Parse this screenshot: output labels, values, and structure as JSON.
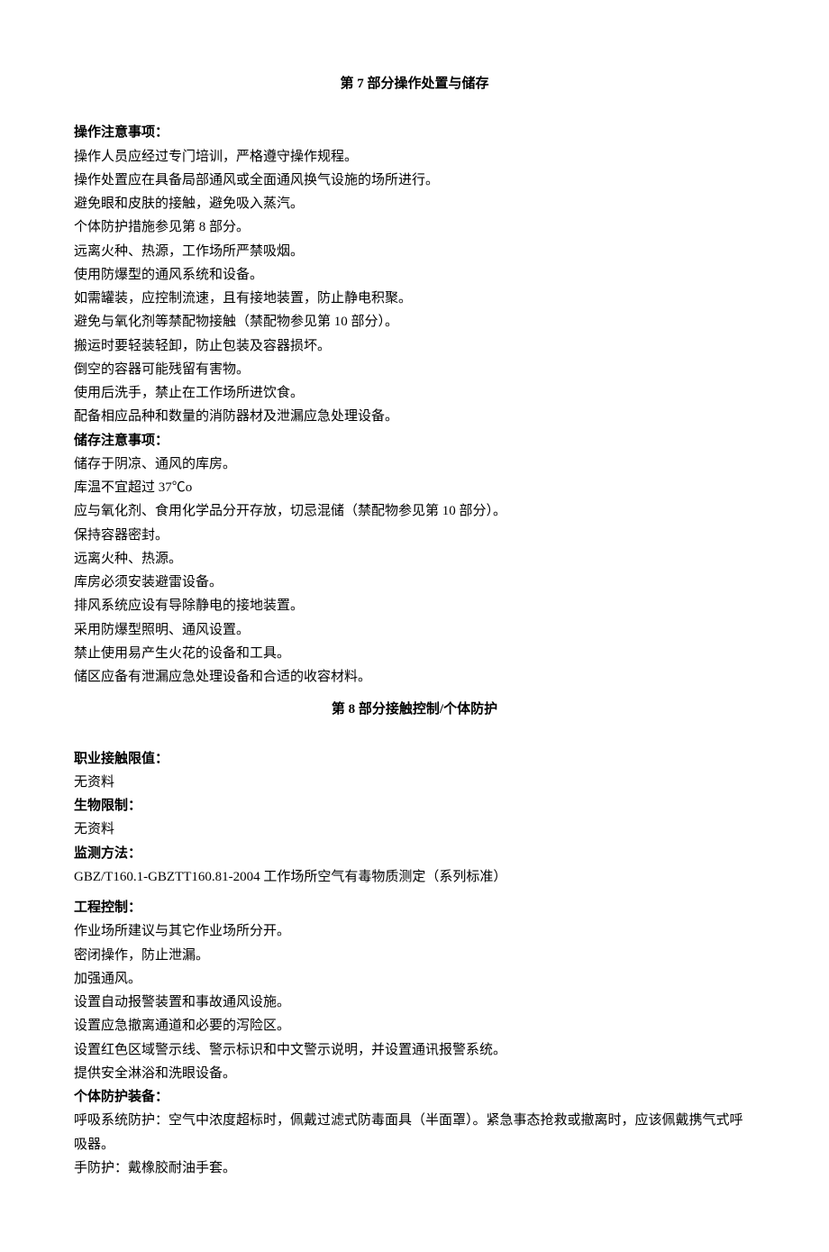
{
  "section7": {
    "title": "第 7 部分操作处置与储存",
    "handling_label": "操作注意事项：",
    "handling_lines": [
      "操作人员应经过专门培训，严格遵守操作规程。",
      "操作处置应在具备局部通风或全面通风换气设施的场所进行。",
      "避免眼和皮肤的接触，避免吸入蒸汽。",
      "个体防护措施参见第 8 部分。",
      "远离火种、热源，工作场所严禁吸烟。",
      "使用防爆型的通风系统和设备。",
      "如需罐装，应控制流速，且有接地装置，防止静电积聚。",
      "避免与氧化剂等禁配物接触（禁配物参见第 10 部分）。",
      "搬运时要轻装轻卸，防止包装及容器损坏。",
      "倒空的容器可能残留有害物。",
      "使用后洗手，禁止在工作场所进饮食。",
      "配备相应品种和数量的消防器材及泄漏应急处理设备。"
    ],
    "storage_label": "储存注意事项：",
    "storage_lines": [
      "储存于阴凉、通风的库房。",
      "库温不宜超过 37℃o",
      "应与氧化剂、食用化学品分开存放，切忌混储（禁配物参见第 10 部分）。",
      "保持容器密封。",
      "远离火种、热源。",
      "库房必须安装避雷设备。",
      "排风系统应设有导除静电的接地装置。",
      "采用防爆型照明、通风设置。",
      "禁止使用易产生火花的设备和工具。",
      "储区应备有泄漏应急处理设备和合适的收容材料。"
    ]
  },
  "section8": {
    "title": "第 8 部分接触控制/个体防护",
    "exposure_label": "职业接触限值：",
    "exposure_value": "无资料",
    "bio_label": "生物限制：",
    "bio_value": "无资料",
    "monitor_label": "监测方法：",
    "monitor_value": "GBZ/T160.1-GBZTT160.81-2004 工作场所空气有毒物质测定（系列标准）",
    "engineering_label": "工程控制：",
    "engineering_lines": [
      "作业场所建议与其它作业场所分开。",
      "密闭操作，防止泄漏。",
      "加强通风。",
      "设置自动报警装置和事故通风设施。",
      "设置应急撤离通道和必要的泻险区。",
      "设置红色区域警示线、警示标识和中文警示说明，并设置通讯报警系统。",
      "提供安全淋浴和洗眼设备。"
    ],
    "ppe_label": "个体防护装备：",
    "ppe_lines": [
      "呼吸系统防护：空气中浓度超标时，佩戴过滤式防毒面具（半面罩）。紧急事态抢救或撤离时，应该佩戴携气式呼吸器。",
      "手防护：戴橡胶耐油手套。"
    ]
  }
}
